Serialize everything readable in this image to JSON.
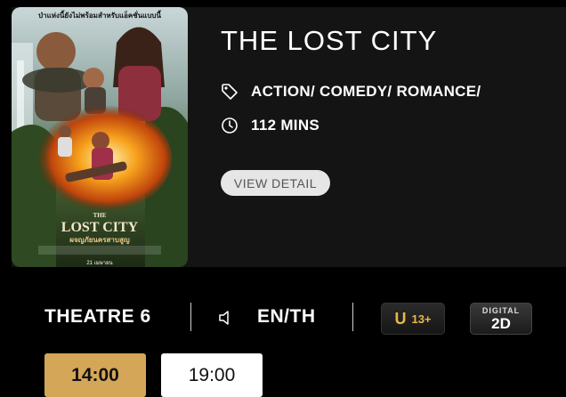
{
  "movie": {
    "title": "THE LOST CITY",
    "genre": "ACTION/ COMEDY/ ROMANCE/",
    "duration": "112 MINS",
    "view_detail_label": "VIEW DETAIL",
    "poster": {
      "tagline": "ป่าแห่งนี้ยังไม่พร้อมสำหรับแอ็คชั่นแบบนี้",
      "logo_line1": "THE",
      "logo_line2": "LOST CITY",
      "thai_title": "ผจญภัยนครสาบสูญ",
      "release": "21 เมษายน"
    }
  },
  "showtime": {
    "theatre": "THEATRE 6",
    "language": "EN/TH",
    "rating_u": "U",
    "rating_age": "13+",
    "format_top": "DIGITAL",
    "format_main": "2D",
    "times": [
      "14:00",
      "19:00"
    ],
    "selected_time": "14:00"
  },
  "colors": {
    "accent_gold": "#d4a657",
    "card_bg": "#141414",
    "page_bg": "#000000"
  },
  "icons": {
    "genre": "tag-icon",
    "duration": "clock-icon",
    "language": "speaker-icon"
  }
}
